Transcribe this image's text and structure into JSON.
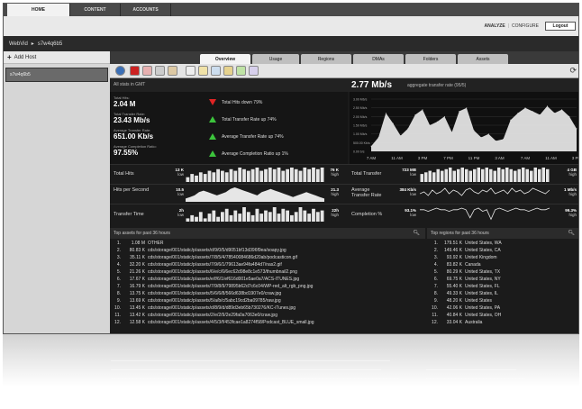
{
  "topnav": {
    "tabs": [
      {
        "label": "HOME",
        "active": true
      },
      {
        "label": "CONTENT",
        "active": false
      },
      {
        "label": "ACCOUNTS",
        "active": false
      }
    ]
  },
  "header": {
    "analyze": "ANALYZE",
    "configure": "CONFIGURE",
    "logout": "Logout"
  },
  "breadcrumb": {
    "root": "WebVid",
    "arrow": "▸",
    "host": "s7w4q6b5"
  },
  "sidebar": {
    "add_host": "Add Host",
    "hosts": [
      "s7w4q6b5"
    ]
  },
  "main_tabs": [
    "Overview",
    "Usage",
    "Regions",
    "DMAs",
    "Folders",
    "Assets"
  ],
  "active_tab": "Overview",
  "stats_bar": {
    "label": "All stats in GMT",
    "rate_value": "2.77 Mb/s",
    "rate_desc": "aggregate transfer rate (95/5)"
  },
  "kpis": [
    {
      "label": "Total Hits:",
      "value": "2.04 M"
    },
    {
      "label": "Total Transfer Rate:",
      "value": "23.43 Mb/s"
    },
    {
      "label": "Average Transfer Rate:",
      "value": "651.00 Kb/s"
    },
    {
      "label": "Average Completion Ratio:",
      "value": "97.55%"
    }
  ],
  "alerts": [
    {
      "dir": "down",
      "text": "Total Hits down 79%"
    },
    {
      "dir": "up",
      "text": "Total Transfer Rate up 74%"
    },
    {
      "dir": "up",
      "text": "Average Transfer Rate up 74%"
    },
    {
      "dir": "up",
      "text": "Average Completion Ratio up 1%"
    }
  ],
  "chart_data": {
    "type": "area",
    "x": [
      "7 AM",
      "11 AM",
      "3 PM",
      "7 PM",
      "11 PM",
      "3 AM",
      "7 AM",
      "11 AM",
      "3 PM"
    ],
    "ylabels": [
      "3.00 Mb/s",
      "2.50 Mb/s",
      "2.00 Mb/s",
      "1.50 Mb/s",
      "1.00 Mb/s",
      "500.00 Kb/s",
      "0.00 b/s"
    ],
    "ylim": [
      0,
      3
    ],
    "values": [
      0.3,
      0.8,
      2.2,
      1.6,
      0.9,
      1.3,
      2.1,
      2.4,
      1.5,
      1.7,
      2.0,
      1.1,
      2.3,
      2.5,
      1.2,
      0.8,
      1.0,
      0.6,
      0.7,
      1.8,
      2.2,
      2.5,
      2.3,
      2.1,
      2.6,
      2.2,
      2.4,
      2.0,
      1.3
    ],
    "color": "#e8e8e8",
    "grid": true
  },
  "sparklines": [
    {
      "label": "Total Hits",
      "low": "13 K",
      "high": "76 K",
      "type": "bar",
      "values": [
        3,
        5,
        4,
        6,
        5,
        7,
        6,
        8,
        7,
        6,
        8,
        7,
        9,
        8,
        7,
        8,
        9,
        7,
        8,
        9,
        8,
        9,
        7,
        8,
        9,
        8,
        7,
        9,
        8,
        9,
        8,
        9
      ]
    },
    {
      "label": "Hits per Second",
      "low": "10.5",
      "high": "21.3",
      "type": "area",
      "values": [
        2,
        3,
        4,
        6,
        7,
        6,
        5,
        4,
        5,
        6,
        8,
        9,
        8,
        7,
        6,
        5,
        4,
        6,
        7,
        8,
        7,
        6,
        5,
        4,
        3,
        4,
        5,
        6,
        5,
        4,
        3,
        2
      ]
    },
    {
      "label": "Transfer Time",
      "low": "2h",
      "high": "22h",
      "type": "bar",
      "values": [
        2,
        4,
        3,
        6,
        2,
        5,
        7,
        3,
        6,
        8,
        4,
        7,
        5,
        9,
        6,
        4,
        8,
        5,
        7,
        6,
        9,
        5,
        8,
        7,
        4,
        6,
        9,
        7,
        5,
        8,
        6,
        7
      ]
    },
    {
      "label": "Total Transfer",
      "low": "723 MB",
      "high": "4 GB",
      "type": "bar",
      "values": [
        5,
        6,
        7,
        6,
        8,
        7,
        8,
        9,
        7,
        8,
        9,
        8,
        7,
        8,
        9,
        8,
        9,
        8,
        7,
        9,
        8,
        9,
        8,
        7,
        8,
        9,
        8,
        7,
        9,
        8,
        9,
        8
      ]
    },
    {
      "label": "Average Transfer Rate",
      "low": "384 Kb/s",
      "high": "1 Mb/s",
      "type": "line",
      "values": [
        5,
        6,
        4,
        7,
        5,
        6,
        8,
        5,
        7,
        6,
        4,
        7,
        8,
        6,
        5,
        7,
        6,
        8,
        5,
        6,
        7,
        5,
        8,
        6,
        7,
        5,
        6,
        8,
        7,
        6,
        5,
        7
      ]
    },
    {
      "label": "Completion %",
      "low": "93.1%",
      "high": "99.3%",
      "type": "line",
      "values": [
        8,
        8,
        7,
        8,
        9,
        8,
        8,
        7,
        8,
        8,
        9,
        8,
        3,
        8,
        9,
        7,
        8,
        2,
        8,
        9,
        8,
        7,
        8,
        9,
        8,
        8,
        7,
        8,
        9,
        8,
        8,
        9
      ]
    }
  ],
  "sparkline_unit_low": "low",
  "sparkline_unit_high": "high",
  "assets": {
    "title": "Top assets for past 36 hours",
    "rows": [
      {
        "n": "1.",
        "v": "1.08 M",
        "name": "OTHER"
      },
      {
        "n": "2.",
        "v": "80.83 K",
        "name": "cds/storage/001/static/p/assets/d/9/0/5/d9051bf13d396f9ea/soapy.jpg"
      },
      {
        "n": "3.",
        "v": "35.11 K",
        "name": "cds/storage/001/static/p/assets/7/8/5/4/78540084686d20ab/podcasticon.gif"
      },
      {
        "n": "4.",
        "v": "32.20 K",
        "name": "cds/storage/001/static/p/assets/7/9/6/1/79613ae94fa484d7/nas2.gif"
      },
      {
        "n": "5.",
        "v": "21.26 K",
        "name": "cds/storage/001/static/p/assets/6/e/c/6/6ec62d98e8c1e573/thumbnail2.png"
      },
      {
        "n": "6.",
        "v": "17.67 K",
        "name": "cds/storage/001/static/p/assets/e/f/6/1/ef616d001e5ae0a7/ACS-ITUNES.jpg"
      },
      {
        "n": "7.",
        "v": "16.79 K",
        "name": "cds/storage/001/static/p/assets/7/9/8/9/79895b62d7c6c04/WP-red_alt_rgb_png.jpg"
      },
      {
        "n": "8.",
        "v": "13.75 K",
        "name": "cds/storage/001/static/p/assets/5/6/6/8/566d638bd1907e0/craw.jpg"
      },
      {
        "n": "9.",
        "v": "13.69 K",
        "name": "cds/storage/001/static/p/assets/5/a/b/c/5abc19cd2ba09785/raw.jpg"
      },
      {
        "n": "10.",
        "v": "13.45 K",
        "name": "cds/storage/001/static/p/assets/d/8/9/d/d89d3eb65b730276/KC-iTunes.jpg"
      },
      {
        "n": "11.",
        "v": "13.42 K",
        "name": "cds/storage/001/static/p/assets/2/e/2/9/2e29fa0a7063e0/craw.jpg"
      },
      {
        "n": "12.",
        "v": "12.58 K",
        "name": "cds/storage/001/static/p/assets/4/5/3/f/453fcae1a8274f58/Podcast_BLUE_small.jpg"
      }
    ]
  },
  "regions": {
    "title": "Top regions for past 36 hours",
    "rows": [
      {
        "n": "1.",
        "v": "179.51 K",
        "name": "United States, WA"
      },
      {
        "n": "2.",
        "v": "149.46 K",
        "name": "United States, CA"
      },
      {
        "n": "3.",
        "v": "93.92 K",
        "name": "United Kingdom"
      },
      {
        "n": "4.",
        "v": "83.82 K",
        "name": "Canada"
      },
      {
        "n": "5.",
        "v": "80.29 K",
        "name": "United States, TX"
      },
      {
        "n": "6.",
        "v": "69.75 K",
        "name": "United States, NY"
      },
      {
        "n": "7.",
        "v": "55.40 K",
        "name": "United States, FL"
      },
      {
        "n": "8.",
        "v": "49.33 K",
        "name": "United States, IL"
      },
      {
        "n": "9.",
        "v": "48.20 K",
        "name": "United States"
      },
      {
        "n": "10.",
        "v": "42.06 K",
        "name": "United States, PA"
      },
      {
        "n": "11.",
        "v": "40.84 K",
        "name": "United States, OH"
      },
      {
        "n": "12.",
        "v": "33.04 K",
        "name": "Australia"
      }
    ]
  },
  "colors": {
    "accent_green": "#3cc43c",
    "accent_red": "#e02424",
    "bg_dark": "#161616"
  }
}
